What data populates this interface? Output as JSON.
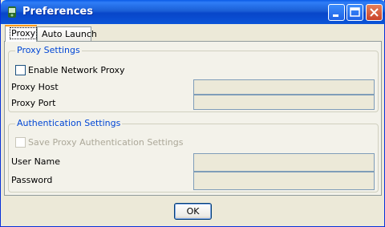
{
  "window": {
    "title": "Preferences"
  },
  "tabs": [
    {
      "label": "Proxy",
      "active": true
    },
    {
      "label": "Auto Launch",
      "active": false
    }
  ],
  "proxy_settings": {
    "group_title": "Proxy Settings",
    "enable_label": "Enable Network Proxy",
    "enable_checked": false,
    "host_label": "Proxy Host",
    "host_value": "",
    "port_label": "Proxy Port",
    "port_value": ""
  },
  "auth_settings": {
    "group_title": "Authentication Settings",
    "save_label": "Save Proxy Authentication Settings",
    "save_checked": false,
    "save_enabled": false,
    "user_label": "User Name",
    "user_value": "",
    "password_label": "Password",
    "password_value": ""
  },
  "buttons": {
    "ok_label": "OK"
  },
  "colors": {
    "titlebar": "#0a54d8",
    "group_title": "#0046d5",
    "active_tab_accent": "#ff9a1a"
  }
}
